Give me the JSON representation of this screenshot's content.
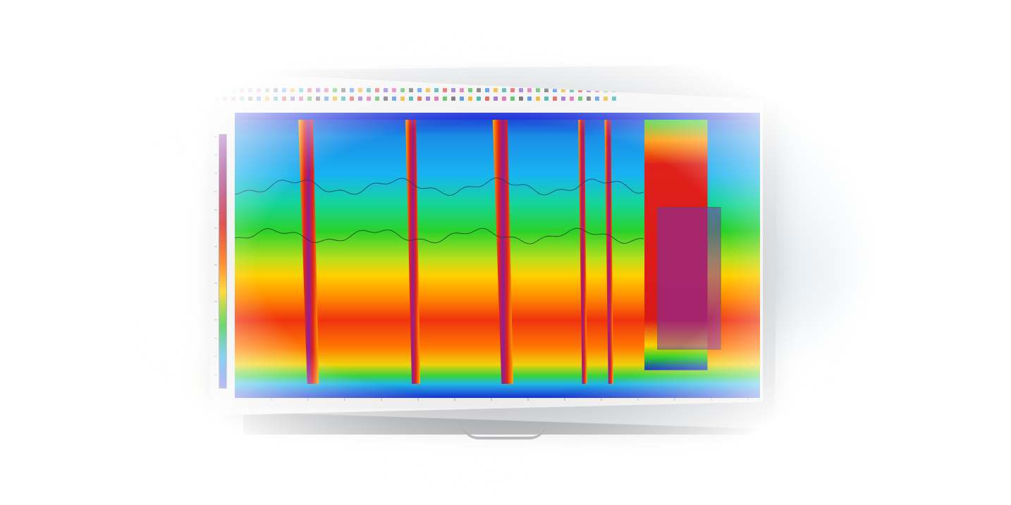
{
  "window": {
    "menu_items": [],
    "toolbar_labels": []
  },
  "colors": {
    "low": "#1a2fcf",
    "cyan": "#18a0e8",
    "green": "#22c322",
    "yellow": "#ffd000",
    "orange": "#ff6a00",
    "red": "#d21a1a",
    "purple": "#7a1fa2",
    "header_strip": "#1d33d8"
  },
  "spectrogram": {
    "event_columns": [
      {
        "x": 0.135,
        "width": 0.028
      },
      {
        "x": 0.335,
        "width": 0.02
      },
      {
        "x": 0.505,
        "width": 0.028
      },
      {
        "x": 0.66,
        "width": 0.012
      },
      {
        "x": 0.71,
        "width": 0.012
      }
    ],
    "red_block": {
      "x_start": 0.78,
      "x_end": 0.9
    },
    "overlay_box": {
      "x_start": 0.805,
      "x_end": 0.925,
      "y_start": 0.32,
      "y_end": 0.8
    }
  }
}
